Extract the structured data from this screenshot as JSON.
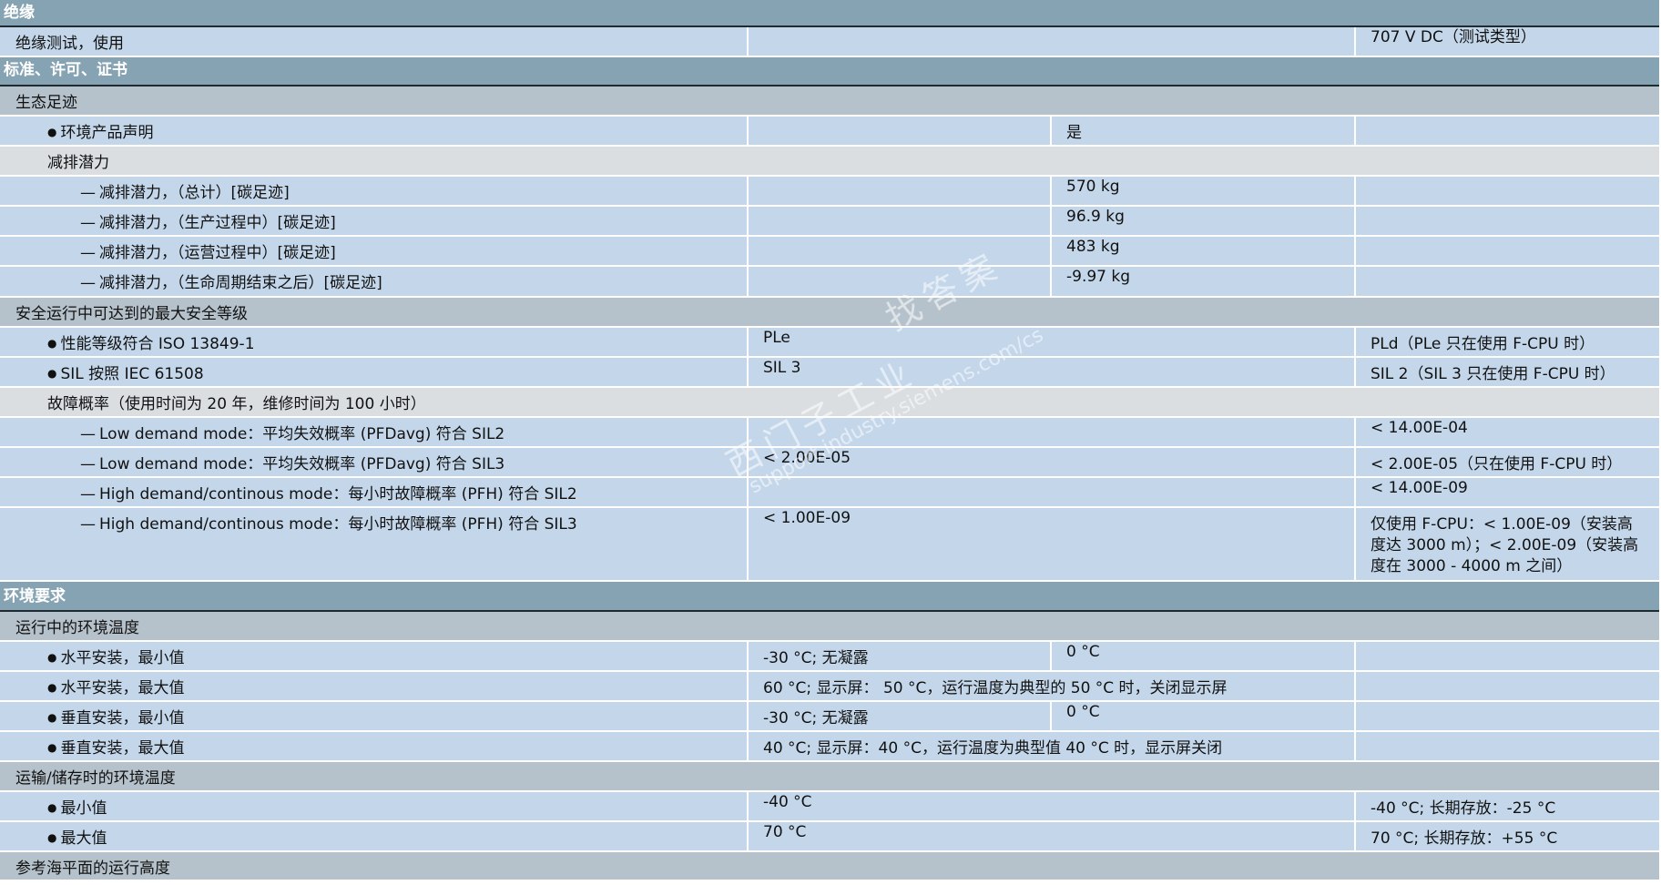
{
  "sections": {
    "insulation": {
      "title": "绝缘",
      "test_label": "绝缘测试，使用",
      "test_value": "707 V DC（测试类型）"
    },
    "standards": {
      "title": "标准、许可、证书",
      "eco_group": "生态足迹",
      "epd_label": "环境产品声明",
      "epd_value": "是",
      "reduction_group": "减排潜力",
      "reductions": [
        {
          "label": "减排潜力，（总计）[碳足迹]",
          "value": "570 kg"
        },
        {
          "label": "减排潜力，（生产过程中）[碳足迹]",
          "value": "96.9 kg"
        },
        {
          "label": "减排潜力，（运营过程中）[碳足迹]",
          "value": "483 kg"
        },
        {
          "label": "减排潜力，（生命周期结束之后）[碳足迹]",
          "value": "-9.97 kg"
        }
      ],
      "safety_group": "安全运行中可达到的最大安全等级",
      "pl_label": "性能等级符合 ISO 13849-1",
      "pl_v1": "PLe",
      "pl_v3": "PLd（PLe 只在使用 F-CPU 时）",
      "sil_label": "SIL 按照 IEC 61508",
      "sil_v1": "SIL 3",
      "sil_v3": "SIL 2（SIL 3 只在使用 F-CPU 时）",
      "failure_group": "故障概率（使用时间为 20 年，维修时间为 100 小时）",
      "ld_sil2_label": "Low demand mode：平均失效概率 (PFDavg) 符合 SIL2",
      "ld_sil2_v3": "< 14.00E-04",
      "ld_sil3_label": "Low demand mode：平均失效概率 (PFDavg) 符合 SIL3",
      "ld_sil3_v1": "< 2.00E-05",
      "ld_sil3_v3": "< 2.00E-05（只在使用 F-CPU 时）",
      "hd_sil2_label": "High demand/continous mode：每小时故障概率 (PFH) 符合 SIL2",
      "hd_sil2_v3": "< 14.00E-09",
      "hd_sil3_label": "High demand/continous mode：每小时故障概率 (PFH) 符合 SIL3",
      "hd_sil3_v1": "< 1.00E-09",
      "hd_sil3_v3": "仅使用 F-CPU：< 1.00E-09（安装高度达 3000 m）；< 2.00E-09（安装高度在 3000 - 4000 m 之间）"
    },
    "environment": {
      "title": "环境要求",
      "op_group": "运行中的环境温度",
      "h_min_label": "水平安装，最小值",
      "h_min_v1": "-30 °C; 无凝露",
      "h_min_v2": "0 °C",
      "h_max_label": "水平安装，最大值",
      "h_max_v": "60 °C; 显示屏： 50 °C，运行温度为典型的 50 °C 时，关闭显示屏",
      "v_min_label": "垂直安装，最小值",
      "v_min_v1": "-30 °C; 无凝露",
      "v_min_v2": "0 °C",
      "v_max_label": "垂直安装，最大值",
      "v_max_v": "40 °C; 显示屏：40 °C，运行温度为典型值 40 °C 时，显示屏关闭",
      "st_group": "运输/储存时的环境温度",
      "st_min_label": "最小值",
      "st_min_v1": "-40 °C",
      "st_min_v3": "-40 °C; 长期存放：-25 °C",
      "st_max_label": "最大值",
      "st_max_v1": "70 °C",
      "st_max_v3": "70 °C; 长期存放：+55 °C",
      "alt_group": "参考海平面的运行高度"
    }
  },
  "watermark": {
    "line1": "西门子工业",
    "line2": "找答案",
    "line3": "support.industry.siemens.com/cs"
  }
}
